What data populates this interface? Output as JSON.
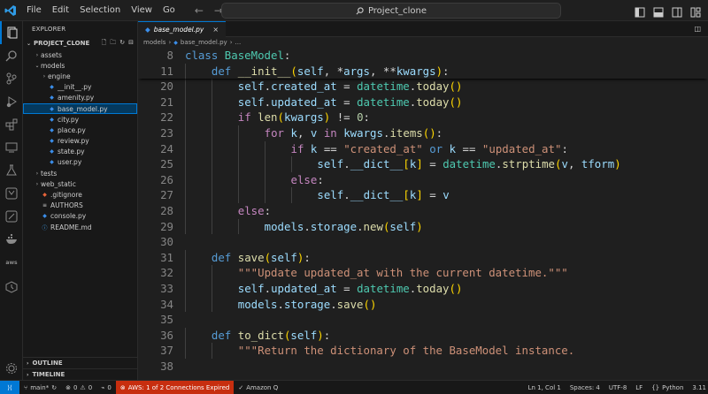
{
  "app": {
    "menu": [
      "File",
      "Edit",
      "Selection",
      "View",
      "Go"
    ],
    "search": "Project_clone"
  },
  "activity_bar": [
    "explorer-icon",
    "search-icon",
    "source-control-icon",
    "run-debug-icon",
    "extensions-icon",
    "remote-explorer-icon",
    "testing-icon",
    "github-icon",
    "gitlens-icon",
    "docker-icon",
    "aws-icon",
    "timeline-icon",
    "settings-icon"
  ],
  "sidebar": {
    "header": "EXPLORER",
    "root": "PROJECT_CLONE",
    "tree": [
      {
        "label": "assets",
        "kind": "folder",
        "depth": 1,
        "open": false
      },
      {
        "label": "models",
        "kind": "folder",
        "depth": 1,
        "open": true
      },
      {
        "label": "engine",
        "kind": "folder",
        "depth": 2,
        "open": false
      },
      {
        "label": "__init__.py",
        "kind": "py",
        "depth": 2
      },
      {
        "label": "amenity.py",
        "kind": "py",
        "depth": 2
      },
      {
        "label": "base_model.py",
        "kind": "py",
        "depth": 2,
        "selected": true
      },
      {
        "label": "city.py",
        "kind": "py",
        "depth": 2
      },
      {
        "label": "place.py",
        "kind": "py",
        "depth": 2
      },
      {
        "label": "review.py",
        "kind": "py",
        "depth": 2
      },
      {
        "label": "state.py",
        "kind": "py",
        "depth": 2
      },
      {
        "label": "user.py",
        "kind": "py",
        "depth": 2
      },
      {
        "label": "tests",
        "kind": "folder",
        "depth": 1,
        "open": false
      },
      {
        "label": "web_static",
        "kind": "folder",
        "depth": 1,
        "open": false
      },
      {
        "label": ".gitignore",
        "kind": "git",
        "depth": 1
      },
      {
        "label": "AUTHORS",
        "kind": "txt",
        "depth": 1
      },
      {
        "label": "console.py",
        "kind": "py",
        "depth": 1
      },
      {
        "label": "README.md",
        "kind": "md",
        "depth": 1
      }
    ],
    "outline": "OUTLINE",
    "timeline": "TIMELINE"
  },
  "editor": {
    "tab": "base_model.py",
    "breadcrumb": [
      "models",
      "base_model.py",
      "..."
    ],
    "sticky_lines": [
      {
        "n": "8",
        "indent": 0,
        "tokens": [
          [
            "kw",
            "class"
          ],
          [
            "op",
            " "
          ],
          [
            "cls",
            "BaseModel"
          ],
          [
            "op",
            ":"
          ]
        ]
      },
      {
        "n": "11",
        "indent": 1,
        "tokens": [
          [
            "kw",
            "def"
          ],
          [
            "op",
            " "
          ],
          [
            "fn",
            "__init__"
          ],
          [
            "p1",
            "("
          ],
          [
            "self",
            "self"
          ],
          [
            "op",
            ", *"
          ],
          [
            "var",
            "args"
          ],
          [
            "op",
            ", **"
          ],
          [
            "var",
            "kwargs"
          ],
          [
            "p1",
            ")"
          ],
          [
            "op",
            ":"
          ]
        ]
      }
    ],
    "lines": [
      {
        "n": "20",
        "indent": 2,
        "tokens": [
          [
            "self",
            "self"
          ],
          [
            "op",
            "."
          ],
          [
            "var",
            "created_at"
          ],
          [
            "op",
            " = "
          ],
          [
            "cls",
            "datetime"
          ],
          [
            "op",
            "."
          ],
          [
            "fn",
            "today"
          ],
          [
            "p1",
            "()"
          ]
        ]
      },
      {
        "n": "21",
        "indent": 2,
        "tokens": [
          [
            "self",
            "self"
          ],
          [
            "op",
            "."
          ],
          [
            "var",
            "updated_at"
          ],
          [
            "op",
            " = "
          ],
          [
            "cls",
            "datetime"
          ],
          [
            "op",
            "."
          ],
          [
            "fn",
            "today"
          ],
          [
            "p1",
            "()"
          ]
        ]
      },
      {
        "n": "22",
        "indent": 2,
        "tokens": [
          [
            "ctl",
            "if"
          ],
          [
            "op",
            " "
          ],
          [
            "fn",
            "len"
          ],
          [
            "p1",
            "("
          ],
          [
            "var",
            "kwargs"
          ],
          [
            "p1",
            ")"
          ],
          [
            "op",
            " != "
          ],
          [
            "num",
            "0"
          ],
          [
            "op",
            ":"
          ]
        ]
      },
      {
        "n": "23",
        "indent": 3,
        "tokens": [
          [
            "ctl",
            "for"
          ],
          [
            "op",
            " "
          ],
          [
            "var",
            "k"
          ],
          [
            "op",
            ", "
          ],
          [
            "var",
            "v"
          ],
          [
            "op",
            " "
          ],
          [
            "ctl",
            "in"
          ],
          [
            "op",
            " "
          ],
          [
            "var",
            "kwargs"
          ],
          [
            "op",
            "."
          ],
          [
            "fn",
            "items"
          ],
          [
            "p1",
            "()"
          ],
          [
            "op",
            ":"
          ]
        ]
      },
      {
        "n": "24",
        "indent": 4,
        "tokens": [
          [
            "ctl",
            "if"
          ],
          [
            "op",
            " "
          ],
          [
            "var",
            "k"
          ],
          [
            "op",
            " == "
          ],
          [
            "str",
            "\"created_at\""
          ],
          [
            "op",
            " "
          ],
          [
            "kw",
            "or"
          ],
          [
            "op",
            " "
          ],
          [
            "var",
            "k"
          ],
          [
            "op",
            " == "
          ],
          [
            "str",
            "\"updated_at\""
          ],
          [
            "op",
            ":"
          ]
        ]
      },
      {
        "n": "25",
        "indent": 5,
        "tokens": [
          [
            "self",
            "self"
          ],
          [
            "op",
            "."
          ],
          [
            "var",
            "__dict__"
          ],
          [
            "p1",
            "["
          ],
          [
            "var",
            "k"
          ],
          [
            "p1",
            "]"
          ],
          [
            "op",
            " = "
          ],
          [
            "cls",
            "datetime"
          ],
          [
            "op",
            "."
          ],
          [
            "fn",
            "strptime"
          ],
          [
            "p1",
            "("
          ],
          [
            "var",
            "v"
          ],
          [
            "op",
            ", "
          ],
          [
            "var",
            "tform"
          ],
          [
            "p1",
            ")"
          ]
        ]
      },
      {
        "n": "26",
        "indent": 4,
        "tokens": [
          [
            "ctl",
            "else"
          ],
          [
            "op",
            ":"
          ]
        ]
      },
      {
        "n": "27",
        "indent": 5,
        "tokens": [
          [
            "self",
            "self"
          ],
          [
            "op",
            "."
          ],
          [
            "var",
            "__dict__"
          ],
          [
            "p1",
            "["
          ],
          [
            "var",
            "k"
          ],
          [
            "p1",
            "]"
          ],
          [
            "op",
            " = "
          ],
          [
            "var",
            "v"
          ]
        ]
      },
      {
        "n": "28",
        "indent": 2,
        "tokens": [
          [
            "ctl",
            "else"
          ],
          [
            "op",
            ":"
          ]
        ]
      },
      {
        "n": "29",
        "indent": 3,
        "tokens": [
          [
            "var",
            "models"
          ],
          [
            "op",
            "."
          ],
          [
            "var",
            "storage"
          ],
          [
            "op",
            "."
          ],
          [
            "fn",
            "new"
          ],
          [
            "p1",
            "("
          ],
          [
            "self",
            "self"
          ],
          [
            "p1",
            ")"
          ]
        ]
      },
      {
        "n": "30",
        "indent": 0,
        "tokens": []
      },
      {
        "n": "31",
        "indent": 1,
        "tokens": [
          [
            "kw",
            "def"
          ],
          [
            "op",
            " "
          ],
          [
            "fn",
            "save"
          ],
          [
            "p1",
            "("
          ],
          [
            "self",
            "self"
          ],
          [
            "p1",
            ")"
          ],
          [
            "op",
            ":"
          ]
        ]
      },
      {
        "n": "32",
        "indent": 2,
        "tokens": [
          [
            "str",
            "\"\"\"Update updated_at with the current datetime.\"\"\""
          ]
        ]
      },
      {
        "n": "33",
        "indent": 2,
        "tokens": [
          [
            "self",
            "self"
          ],
          [
            "op",
            "."
          ],
          [
            "var",
            "updated_at"
          ],
          [
            "op",
            " = "
          ],
          [
            "cls",
            "datetime"
          ],
          [
            "op",
            "."
          ],
          [
            "fn",
            "today"
          ],
          [
            "p1",
            "()"
          ]
        ]
      },
      {
        "n": "34",
        "indent": 2,
        "tokens": [
          [
            "var",
            "models"
          ],
          [
            "op",
            "."
          ],
          [
            "var",
            "storage"
          ],
          [
            "op",
            "."
          ],
          [
            "fn",
            "save"
          ],
          [
            "p1",
            "()"
          ]
        ]
      },
      {
        "n": "35",
        "indent": 0,
        "tokens": []
      },
      {
        "n": "36",
        "indent": 1,
        "tokens": [
          [
            "kw",
            "def"
          ],
          [
            "op",
            " "
          ],
          [
            "fn",
            "to_dict"
          ],
          [
            "p1",
            "("
          ],
          [
            "self",
            "self"
          ],
          [
            "p1",
            ")"
          ],
          [
            "op",
            ":"
          ]
        ]
      },
      {
        "n": "37",
        "indent": 2,
        "tokens": [
          [
            "str",
            "\"\"\"Return the dictionary of the BaseModel instance."
          ]
        ]
      },
      {
        "n": "38",
        "indent": 0,
        "tokens": []
      }
    ]
  },
  "statusbar": {
    "branch": "main*",
    "errors": "0",
    "warnings": "0",
    "ports": "0",
    "aws": "AWS: 1 of 2 Connections Expired",
    "amazonq": "Amazon Q",
    "position": "Ln 1, Col 1",
    "spaces": "Spaces: 4",
    "encoding": "UTF-8",
    "eol": "LF",
    "language": "Python",
    "version": "3.11"
  },
  "colors": {
    "accent": "#0078d4",
    "warning_bg": "#c72e0f",
    "selected_bg": "#04395e",
    "python_icon": "#3b8eea",
    "folder_chevron": "#bbbbbb"
  }
}
